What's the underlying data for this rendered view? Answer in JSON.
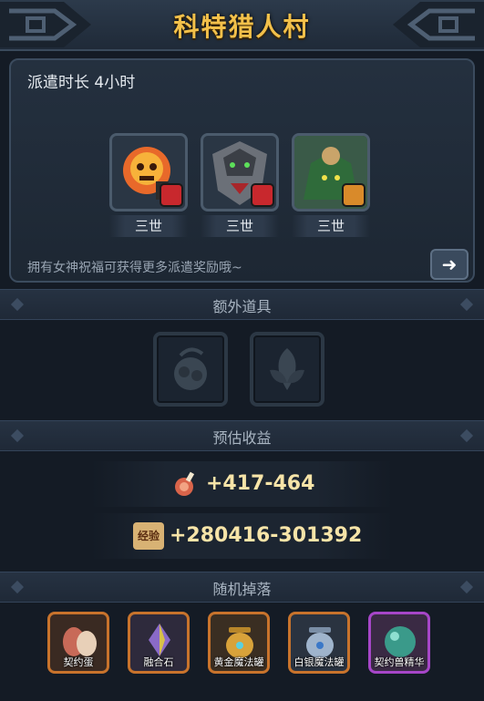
{
  "header": {
    "title": "科特猎人村"
  },
  "dispatch": {
    "duration_label": "派遣时长 4小时"
  },
  "heroes": [
    {
      "name": "fire-skull-hero",
      "generation": "三世",
      "element": "fire",
      "element_color": "#c8282d"
    },
    {
      "name": "armored-beast-hero",
      "generation": "三世",
      "element": "fire",
      "element_color": "#c8282d"
    },
    {
      "name": "moss-creature-hero",
      "generation": "三世",
      "element": "earth",
      "element_color": "#d98a2a"
    }
  ],
  "hint": {
    "text": "拥有女神祝福可获得更多派遣奖励哦~"
  },
  "sections": {
    "extra_items": "额外道具",
    "estimated_income": "预估收益",
    "random_drops": "随机掉落"
  },
  "income": {
    "food": "+417-464",
    "exp_badge": "经验",
    "exp": "+280416-301392"
  },
  "drops": [
    {
      "label": "契约蛋",
      "border": "#c8732c"
    },
    {
      "label": "融合石",
      "border": "#c8732c"
    },
    {
      "label": "黄金魔法罐",
      "border": "#c8732c"
    },
    {
      "label": "白银魔法罐",
      "border": "#c8732c"
    },
    {
      "label": "契约兽精华",
      "border": "#a646c8"
    }
  ],
  "colors": {
    "title": "#f2c04a",
    "value": "#f7e4a8"
  }
}
